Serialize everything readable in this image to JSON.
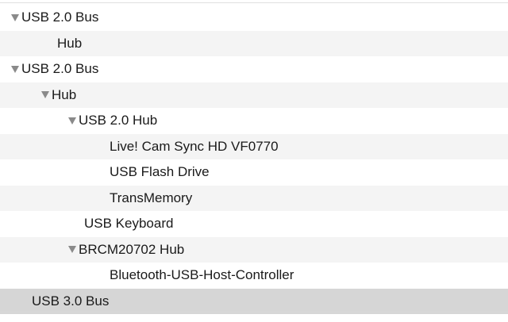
{
  "tree": {
    "rows": [
      {
        "label": "USB 2.0 Bus",
        "expanded": true
      },
      {
        "label": "Hub",
        "expanded": false
      },
      {
        "label": "USB 2.0 Bus",
        "expanded": true
      },
      {
        "label": "Hub",
        "expanded": true
      },
      {
        "label": "USB 2.0 Hub",
        "expanded": true
      },
      {
        "label": "Live! Cam Sync HD VF0770",
        "expanded": false
      },
      {
        "label": "USB Flash Drive",
        "expanded": false
      },
      {
        "label": "TransMemory",
        "expanded": false
      },
      {
        "label": "USB Keyboard",
        "expanded": false
      },
      {
        "label": "BRCM20702 Hub",
        "expanded": true
      },
      {
        "label": "Bluetooth-USB-Host-Controller",
        "expanded": false
      },
      {
        "label": "USB 3.0 Bus",
        "expanded": false,
        "selected": true
      }
    ]
  },
  "colors": {
    "alternate_row": "#f4f4f4",
    "selected_row": "#d6d6d6",
    "disclosure": "#8a8a8a",
    "text": "#1a1a1a"
  },
  "icons": {
    "disclosure": "disclosure-triangle-expanded-icon"
  }
}
